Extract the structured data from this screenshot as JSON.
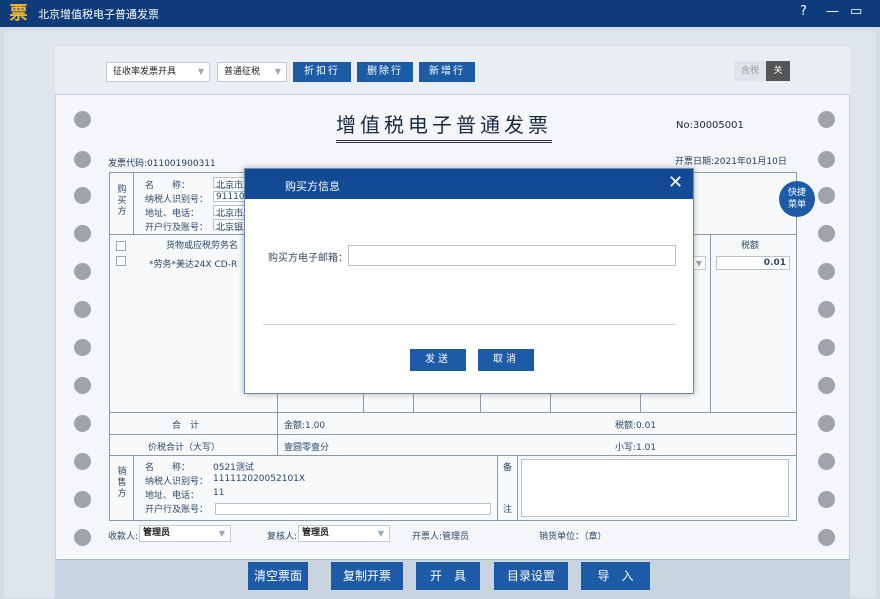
{
  "app": {
    "logo_char": "票",
    "title": "北京增值税电子普通发票",
    "help": "?",
    "minimize": "—",
    "maximize": "▭"
  },
  "toolbar": {
    "invoice_type": "征收率发票开具",
    "tax_mode": "普通征税",
    "buttons": [
      "折扣行",
      "删除行",
      "新增行"
    ],
    "tax_label": "含税",
    "tax_toggle": "关"
  },
  "invoice": {
    "title": "增值税电子普通发票",
    "number": "No:30005001",
    "code": "发票代码:011001900311",
    "date": "开票日期:2021年01月10日",
    "buyer_vertical": [
      "购",
      "买",
      "方"
    ],
    "buyer_fields": [
      {
        "label": "名　　称：",
        "value": "北京市"
      },
      {
        "label": "纳税人识别号：",
        "value": "91110"
      },
      {
        "label": "地址、电话：",
        "value": "北京市"
      },
      {
        "label": "开户行及账号：",
        "value": "北京银"
      }
    ],
    "goods_header": "货物或应税劳务名",
    "tax_amount_header": "税额",
    "item_name": "*劳务*美达24X CD-R",
    "item_tax": "0.01",
    "total_label": "合　计",
    "total_amount": "金额:1.00",
    "total_tax": "税额:0.01",
    "price_tax_label": "价税合计（大写）",
    "price_tax_upper": "壹圆零壹分",
    "price_tax_lower": "小写:1.01",
    "seller_vertical": [
      "销",
      "售",
      "方"
    ],
    "seller_fields": [
      {
        "label": "名　　称：",
        "value": "0521测试"
      },
      {
        "label": "纳税人识别号：",
        "value": "111112020052101X"
      },
      {
        "label": "地址、电话：",
        "value": "11"
      },
      {
        "label": "开户行及账号：",
        "value": ""
      }
    ],
    "remark_top": "备",
    "remark_bottom": "注",
    "payee_label": "收款人:",
    "payee": "管理员",
    "reviewer_label": "复核人:",
    "reviewer": "管理员",
    "drawer": "开票人:管理员",
    "seller_seal": "销货单位：（章）"
  },
  "fast_menu": [
    "快捷",
    "菜单"
  ],
  "bottom_buttons": [
    "清空票面",
    "复制开票",
    "开　具",
    "目录设置",
    "导　入"
  ],
  "dialog": {
    "title": "购买方信息",
    "close": "✕",
    "email_label": "购买方电子邮箱：",
    "email_value": "",
    "send": "发送",
    "cancel": "取消"
  }
}
